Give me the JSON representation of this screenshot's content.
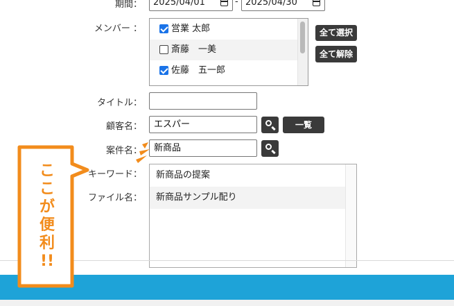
{
  "form": {
    "period": {
      "label": "期間：",
      "from": "2025/04/01",
      "separator": "-",
      "to": "2025/04/30"
    },
    "members": {
      "label": "メンバー ：",
      "items": [
        {
          "name": "営業 太郎",
          "checked": true
        },
        {
          "name": "斎藤　一美",
          "checked": false
        },
        {
          "name": "佐藤　五一郎",
          "checked": true
        }
      ],
      "select_all": "全て選択",
      "clear_all": "全て解除"
    },
    "title": {
      "label": "タイトル：",
      "value": ""
    },
    "customer": {
      "label": "顧客名：",
      "value": "エスパー",
      "list_button": "一覧"
    },
    "project": {
      "label": "案件名：",
      "value": "新商品"
    },
    "keyword": {
      "label": "キーワード："
    },
    "file": {
      "label": "ファイル名："
    },
    "suggestions": [
      "新商品の提案",
      "新商品サンプル配り"
    ]
  },
  "callout": {
    "lines": [
      "こ",
      "こ",
      "が",
      "便",
      "利",
      "!!"
    ],
    "color": "#f28c1c"
  },
  "colors": {
    "footer_band": "#1ea3d8",
    "button_dark": "#3a3a3a",
    "checkbox": "#1a73e8"
  }
}
